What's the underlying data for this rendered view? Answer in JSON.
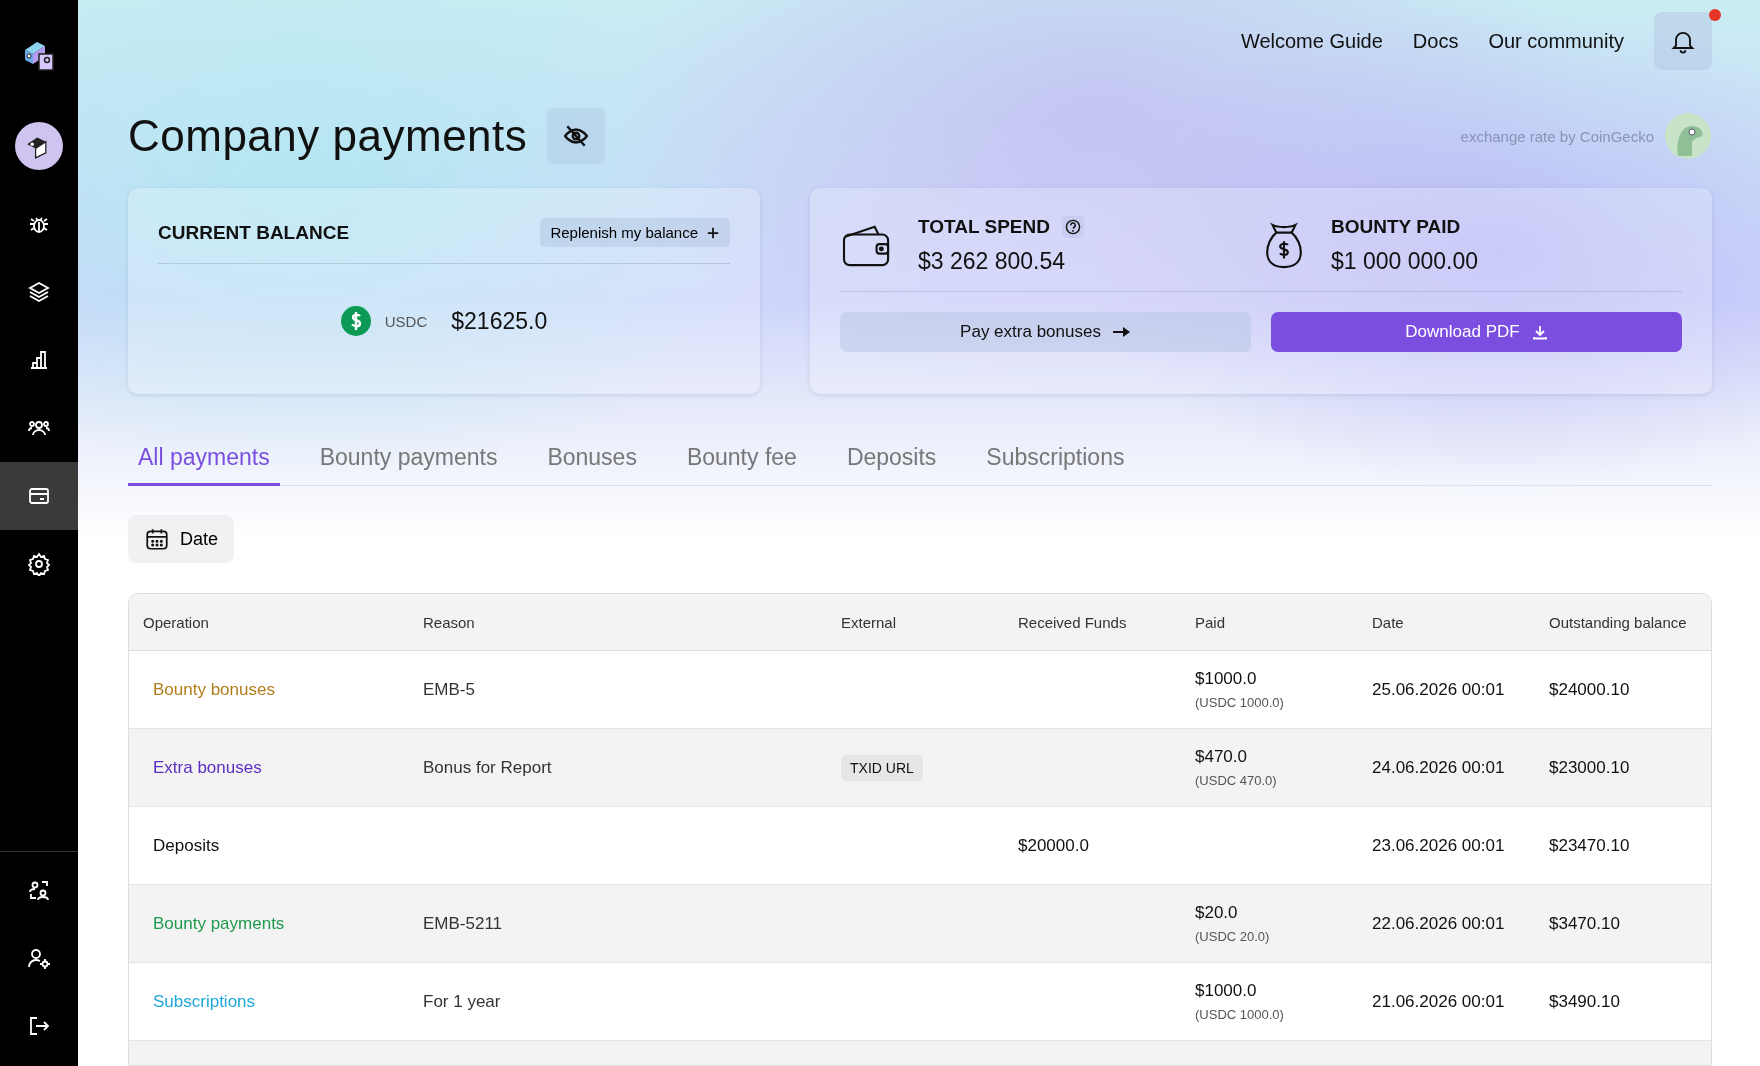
{
  "sidebar": {
    "items": [
      {
        "selected": false
      },
      {
        "selected": false
      },
      {
        "selected": false
      },
      {
        "selected": false
      },
      {
        "selected": true
      },
      {
        "selected": false
      }
    ],
    "bottom_items": [
      {
        "selected": false
      },
      {
        "selected": false
      },
      {
        "selected": false
      }
    ]
  },
  "top_nav": [
    "Welcome Guide",
    "Docs",
    "Our community"
  ],
  "notifications": {
    "unread": true
  },
  "title": "Company payments",
  "exchange_note": "exchange rate by CoinGecko",
  "balance_card": {
    "title": "CURRENT BALANCE",
    "replenish": "Replenish my balance",
    "currency": "USDC",
    "amount": "$21625.0"
  },
  "stats": [
    {
      "title": "TOTAL SPEND",
      "value": "$3 262 800.54",
      "help": true
    },
    {
      "title": "BOUNTY PAID",
      "value": "$1 000 000.00",
      "help": false
    }
  ],
  "actions": {
    "pay": "Pay extra bonuses",
    "download": "Download PDF"
  },
  "tabs": [
    {
      "label": "All payments",
      "selected": true
    },
    {
      "label": "Bounty payments",
      "selected": false
    },
    {
      "label": "Bonuses",
      "selected": false
    },
    {
      "label": "Bounty fee",
      "selected": false
    },
    {
      "label": "Deposits",
      "selected": false
    },
    {
      "label": "Subscriptions",
      "selected": false
    }
  ],
  "date_filter": "Date",
  "table": {
    "columns": [
      "Operation",
      "Reason",
      "External",
      "Received Funds",
      "Paid",
      "Date",
      "Outstanding balance"
    ],
    "rows": [
      {
        "operation": "Bounty bonuses",
        "color": "#b07d1a",
        "reason": "EMB-5",
        "external": "",
        "received": "",
        "paid": "$1000.0",
        "paid_sub": "(USDC 1000.0)",
        "date": "25.06.2026 00:01",
        "outstanding": "$24000.10"
      },
      {
        "operation": "Extra bonuses",
        "color": "#5b2fc0",
        "reason": "Bonus for Report",
        "external": "TXID URL",
        "received": "",
        "paid": "$470.0",
        "paid_sub": "(USDC 470.0)",
        "date": "24.06.2026 00:01",
        "outstanding": "$23000.10"
      },
      {
        "operation": "Deposits",
        "color": "#111111",
        "reason": "",
        "external": "",
        "received": "$20000.0",
        "paid": "",
        "paid_sub": "",
        "date": "23.06.2026 00:01",
        "outstanding": "$23470.10"
      },
      {
        "operation": "Bounty payments",
        "color": "#1f9a4e",
        "reason": "EMB-5211",
        "external": "",
        "received": "",
        "paid": "$20.0",
        "paid_sub": "(USDC 20.0)",
        "date": "22.06.2026 00:01",
        "outstanding": "$3470.10"
      },
      {
        "operation": "Subscriptions",
        "color": "#1ea7d8",
        "reason": "For 1 year",
        "external": "",
        "received": "",
        "paid": "$1000.0",
        "paid_sub": "(USDC 1000.0)",
        "date": "21.06.2026 00:01",
        "outstanding": "$3490.10"
      }
    ]
  }
}
